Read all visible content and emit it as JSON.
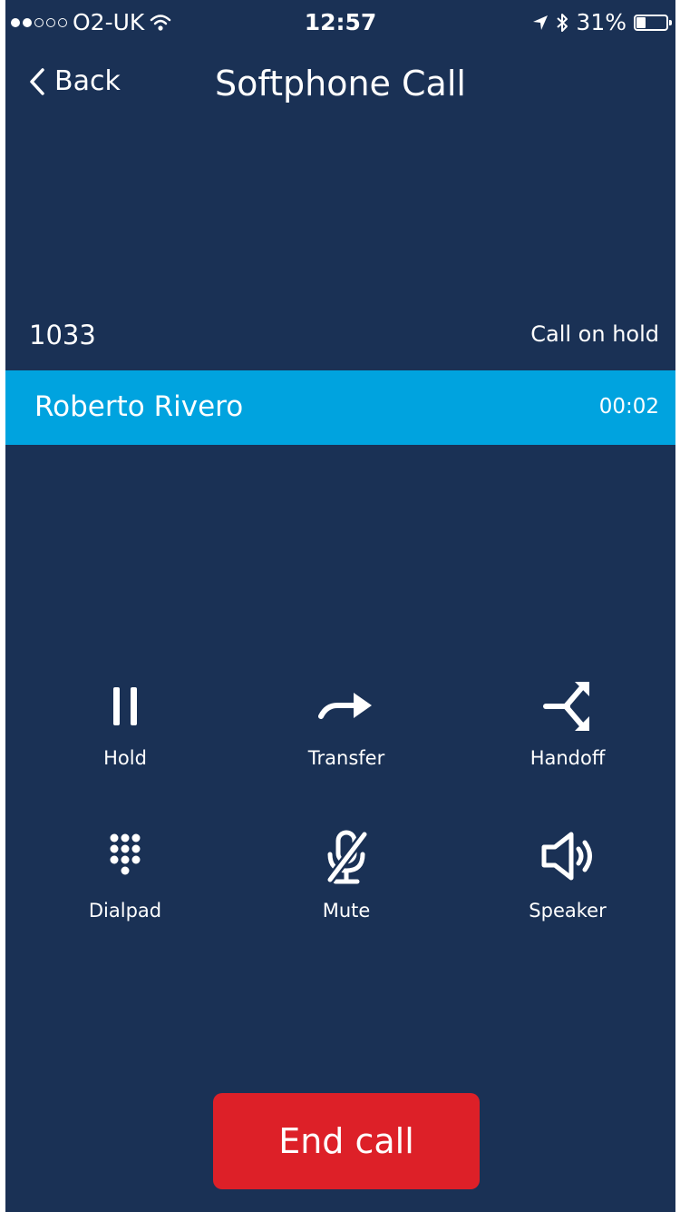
{
  "status_bar": {
    "carrier": "O2-UK",
    "time": "12:57",
    "battery_text": "31%",
    "battery_level": 0.31,
    "signal_bars_filled": 2,
    "signal_bars_total": 5
  },
  "nav": {
    "back_label": "Back",
    "title": "Softphone Call"
  },
  "held_call": {
    "number": "1033",
    "status": "Call on hold"
  },
  "active_call": {
    "name": "Roberto Rivero",
    "duration": "00:02"
  },
  "controls": {
    "hold": "Hold",
    "transfer": "Transfer",
    "handoff": "Handoff",
    "dialpad": "Dialpad",
    "mute": "Mute",
    "speaker": "Speaker"
  },
  "end_call_label": "End call",
  "colors": {
    "background": "#1a3155",
    "active_row": "#00a3df",
    "end_call": "#dd2028",
    "text": "#ffffff"
  },
  "icons": {
    "hold": "pause-icon",
    "transfer": "arrow-right-icon",
    "handoff": "handoff-icon",
    "dialpad": "dialpad-icon",
    "mute": "mic-off-icon",
    "speaker": "speaker-icon"
  }
}
